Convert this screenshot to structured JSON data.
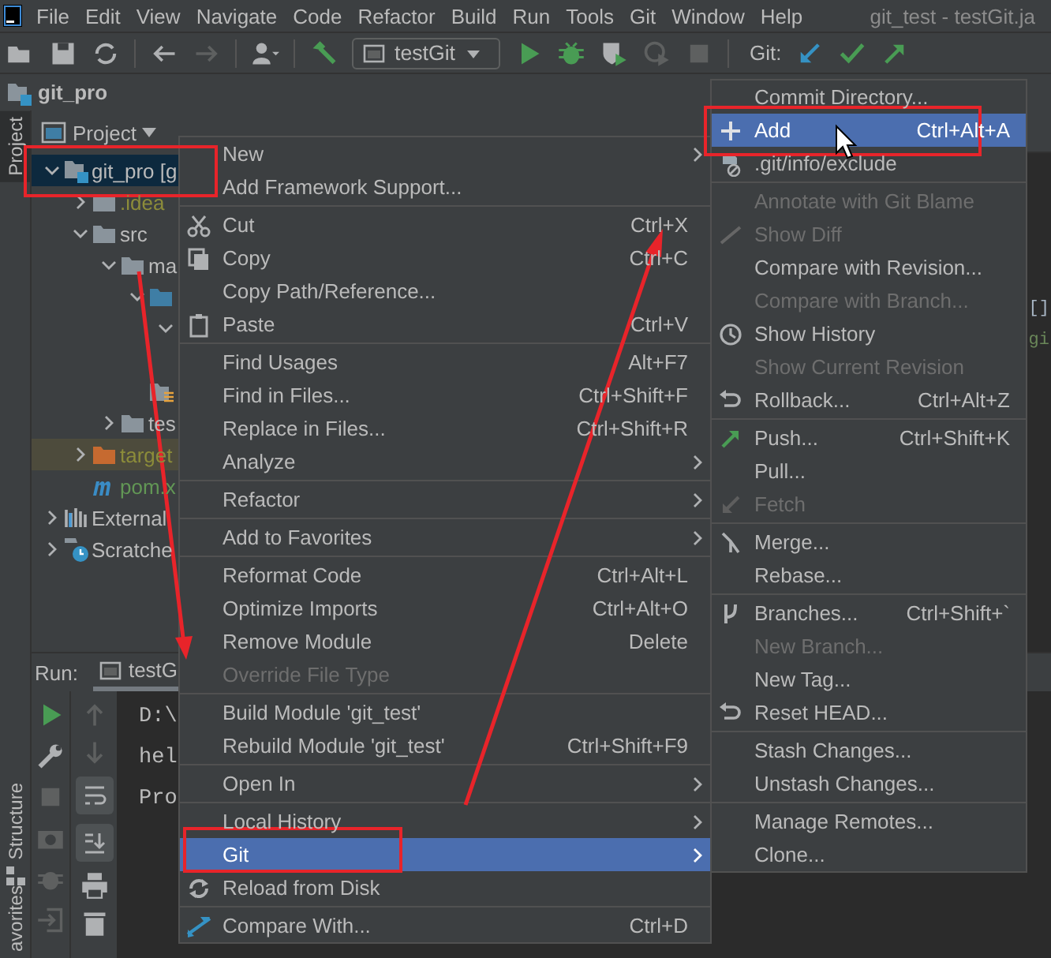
{
  "menu_bar": {
    "items": [
      "File",
      "Edit",
      "View",
      "Navigate",
      "Code",
      "Refactor",
      "Build",
      "Run",
      "Tools",
      "Git",
      "Window",
      "Help"
    ],
    "title": "git_test - testGit.ja"
  },
  "toolbar": {
    "run_config": "testGit",
    "vcs_label": "Git:"
  },
  "breadcrumb": {
    "label": "git_pro"
  },
  "tool_stripe": {
    "project_tab": "Project",
    "structure_tab": "Structure",
    "favorites_tab": "avorites"
  },
  "project_panel": {
    "title": "Project",
    "tree": [
      {
        "label": "git_pro [g",
        "kind": "module",
        "color": "#bbbbbb",
        "selected": true,
        "expanded": true,
        "children": [
          {
            "label": ".idea",
            "kind": "folder",
            "color": "#8c8c3a",
            "selected": false,
            "expanded": false
          },
          {
            "label": "src",
            "kind": "folder",
            "color": "#bbbbbb",
            "selected": false,
            "expanded": true,
            "children": [
              {
                "label": "ma",
                "kind": "folder",
                "color": "#bbbbbb",
                "selected": false,
                "expanded": true,
                "children": [
                  {
                    "kind": "source",
                    "selected": false,
                    "expanded": true,
                    "children": [
                      {
                        "selected": false,
                        "expanded": true,
                        "children": [
                          {
                            "selected": false
                          }
                        ]
                      }
                    ]
                  },
                  {
                    "kind": "resources",
                    "selected": false
                  }
                ]
              },
              {
                "label": "tes",
                "kind": "folder",
                "color": "#bbbbbb",
                "selected": false,
                "expanded": false
              }
            ]
          },
          {
            "label": "target",
            "kind": "excluded",
            "color": "#8c8c3a",
            "selected": false,
            "expanded": false
          },
          {
            "label": "pom.x",
            "kind": "maven",
            "color": "#629755",
            "selected": false
          }
        ]
      },
      {
        "label": "External",
        "kind": "library",
        "color": "#bbbbbb",
        "selected": false,
        "expanded": false
      },
      {
        "label": "Scratche",
        "kind": "scratch",
        "color": "#bbbbbb",
        "selected": false,
        "expanded": false
      }
    ]
  },
  "editor": {
    "lines": [
      {
        "text": "[]",
        "color": "#a9b7c6"
      },
      {
        "text": "gi",
        "color": "#6a8759"
      }
    ]
  },
  "run_panel": {
    "label": "Run:",
    "tab": "testG",
    "console": [
      "D:\\",
      "hel",
      "Pro"
    ]
  },
  "context_menu": {
    "items": [
      {
        "kind": "item",
        "label": "New",
        "selected": false,
        "disabled": false,
        "submenu": true
      },
      {
        "kind": "item",
        "label": "Add Framework Support...",
        "selected": false,
        "disabled": false,
        "submenu": false
      },
      {
        "kind": "separator"
      },
      {
        "kind": "item",
        "label": "Cut",
        "shortcut": "Ctrl+X",
        "selected": false,
        "disabled": false,
        "submenu": false
      },
      {
        "kind": "item",
        "label": "Copy",
        "shortcut": "Ctrl+C",
        "selected": false,
        "disabled": false,
        "submenu": false
      },
      {
        "kind": "item",
        "label": "Copy Path/Reference...",
        "selected": false,
        "disabled": false,
        "submenu": false
      },
      {
        "kind": "item",
        "label": "Paste",
        "shortcut": "Ctrl+V",
        "selected": false,
        "disabled": false,
        "submenu": false
      },
      {
        "kind": "separator"
      },
      {
        "kind": "item",
        "label": "Find Usages",
        "shortcut": "Alt+F7",
        "selected": false,
        "disabled": false,
        "submenu": false
      },
      {
        "kind": "item",
        "label": "Find in Files...",
        "shortcut": "Ctrl+Shift+F",
        "selected": false,
        "disabled": false,
        "submenu": false
      },
      {
        "kind": "item",
        "label": "Replace in Files...",
        "shortcut": "Ctrl+Shift+R",
        "selected": false,
        "disabled": false,
        "submenu": false
      },
      {
        "kind": "item",
        "label": "Analyze",
        "selected": false,
        "disabled": false,
        "submenu": true
      },
      {
        "kind": "separator"
      },
      {
        "kind": "item",
        "label": "Refactor",
        "selected": false,
        "disabled": false,
        "submenu": true
      },
      {
        "kind": "separator"
      },
      {
        "kind": "item",
        "label": "Add to Favorites",
        "selected": false,
        "disabled": false,
        "submenu": true
      },
      {
        "kind": "separator"
      },
      {
        "kind": "item",
        "label": "Reformat Code",
        "shortcut": "Ctrl+Alt+L",
        "selected": false,
        "disabled": false,
        "submenu": false
      },
      {
        "kind": "item",
        "label": "Optimize Imports",
        "shortcut": "Ctrl+Alt+O",
        "selected": false,
        "disabled": false,
        "submenu": false
      },
      {
        "kind": "item",
        "label": "Remove Module",
        "shortcut": "Delete",
        "selected": false,
        "disabled": false,
        "submenu": false
      },
      {
        "kind": "item",
        "label": "Override File Type",
        "selected": false,
        "disabled": true,
        "submenu": false
      },
      {
        "kind": "separator"
      },
      {
        "kind": "item",
        "label": "Build Module 'git_test'",
        "selected": false,
        "disabled": false,
        "submenu": false
      },
      {
        "kind": "item",
        "label": "Rebuild Module 'git_test'",
        "shortcut": "Ctrl+Shift+F9",
        "selected": false,
        "disabled": false,
        "submenu": false
      },
      {
        "kind": "separator"
      },
      {
        "kind": "item",
        "label": "Open In",
        "selected": false,
        "disabled": false,
        "submenu": true
      },
      {
        "kind": "separator"
      },
      {
        "kind": "item",
        "label": "Local History",
        "selected": false,
        "disabled": false,
        "submenu": true
      },
      {
        "kind": "item",
        "label": "Git",
        "selected": true,
        "disabled": false,
        "submenu": true
      },
      {
        "kind": "item",
        "label": "Reload from Disk",
        "selected": false,
        "disabled": false,
        "submenu": false
      },
      {
        "kind": "separator"
      },
      {
        "kind": "item",
        "label": "Compare With...",
        "shortcut": "Ctrl+D",
        "selected": false,
        "disabled": false,
        "submenu": false
      }
    ]
  },
  "git_submenu": {
    "items": [
      {
        "kind": "item",
        "label": "Commit Directory...",
        "selected": false,
        "disabled": false
      },
      {
        "kind": "item",
        "label": "Add",
        "shortcut": "Ctrl+Alt+A",
        "selected": true,
        "disabled": false
      },
      {
        "kind": "item",
        "label": ".git/info/exclude",
        "selected": false,
        "disabled": false
      },
      {
        "kind": "separator"
      },
      {
        "kind": "item",
        "label": "Annotate with Git Blame",
        "selected": false,
        "disabled": true
      },
      {
        "kind": "item",
        "label": "Show Diff",
        "selected": false,
        "disabled": true
      },
      {
        "kind": "item",
        "label": "Compare with Revision...",
        "selected": false,
        "disabled": false
      },
      {
        "kind": "item",
        "label": "Compare with Branch...",
        "selected": false,
        "disabled": true
      },
      {
        "kind": "item",
        "label": "Show History",
        "selected": false,
        "disabled": false
      },
      {
        "kind": "item",
        "label": "Show Current Revision",
        "selected": false,
        "disabled": true
      },
      {
        "kind": "item",
        "label": "Rollback...",
        "shortcut": "Ctrl+Alt+Z",
        "selected": false,
        "disabled": false
      },
      {
        "kind": "separator"
      },
      {
        "kind": "item",
        "label": "Push...",
        "shortcut": "Ctrl+Shift+K",
        "selected": false,
        "disabled": false
      },
      {
        "kind": "item",
        "label": "Pull...",
        "selected": false,
        "disabled": false
      },
      {
        "kind": "item",
        "label": "Fetch",
        "selected": false,
        "disabled": true
      },
      {
        "kind": "separator"
      },
      {
        "kind": "item",
        "label": "Merge...",
        "selected": false,
        "disabled": false
      },
      {
        "kind": "item",
        "label": "Rebase...",
        "selected": false,
        "disabled": false
      },
      {
        "kind": "separator"
      },
      {
        "kind": "item",
        "label": "Branches...",
        "shortcut": "Ctrl+Shift+`",
        "selected": false,
        "disabled": false
      },
      {
        "kind": "item",
        "label": "New Branch...",
        "selected": false,
        "disabled": true
      },
      {
        "kind": "item",
        "label": "New Tag...",
        "selected": false,
        "disabled": false
      },
      {
        "kind": "item",
        "label": "Reset HEAD...",
        "selected": false,
        "disabled": false
      },
      {
        "kind": "separator"
      },
      {
        "kind": "item",
        "label": "Stash Changes...",
        "selected": false,
        "disabled": false
      },
      {
        "kind": "item",
        "label": "Unstash Changes...",
        "selected": false,
        "disabled": false
      },
      {
        "kind": "separator"
      },
      {
        "kind": "item",
        "label": "Manage Remotes...",
        "selected": false,
        "disabled": false
      },
      {
        "kind": "item",
        "label": "Clone...",
        "selected": false,
        "disabled": false
      }
    ]
  }
}
